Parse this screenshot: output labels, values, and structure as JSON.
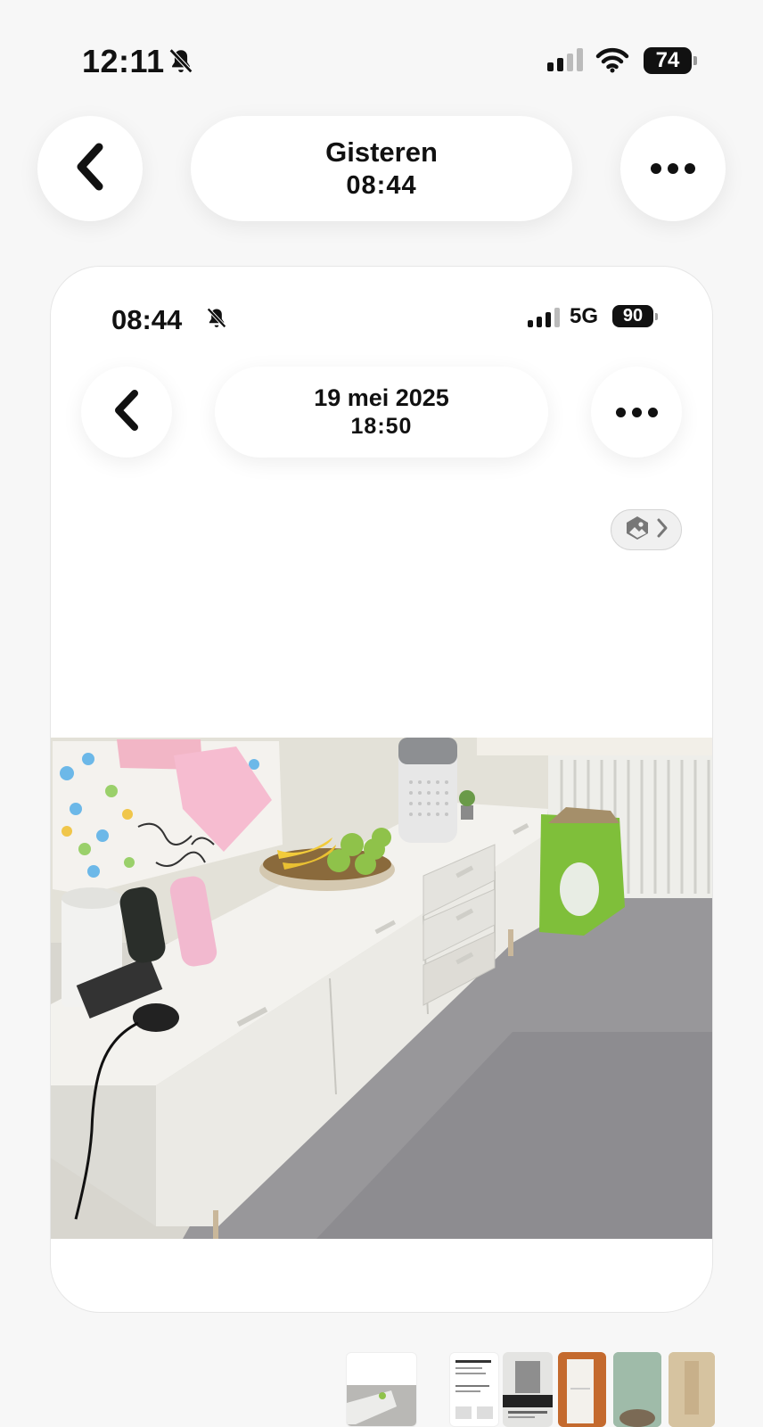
{
  "status_bar": {
    "time": "12:11",
    "battery": "74",
    "icons": [
      "bell-slash-icon",
      "cellular-signal-icon",
      "wifi-icon",
      "battery-icon"
    ]
  },
  "nav": {
    "title_line1": "Gisteren",
    "title_line2": "08:44",
    "back_icon": "chevron-left-icon",
    "more_icon": "ellipsis-icon"
  },
  "screenshot": {
    "status_bar": {
      "time": "08:44",
      "network": "5G",
      "battery": "90"
    },
    "nav": {
      "title_line1": "19 mei 2025",
      "title_line2": "18:50"
    },
    "badge_icon": "photo-gallery-icon",
    "photo_description_icon": "photo"
  },
  "colors": {
    "background": "#f7f7f7",
    "card": "#ffffff",
    "accent_dark": "#111111"
  },
  "thumbnails_count_visible": 6
}
